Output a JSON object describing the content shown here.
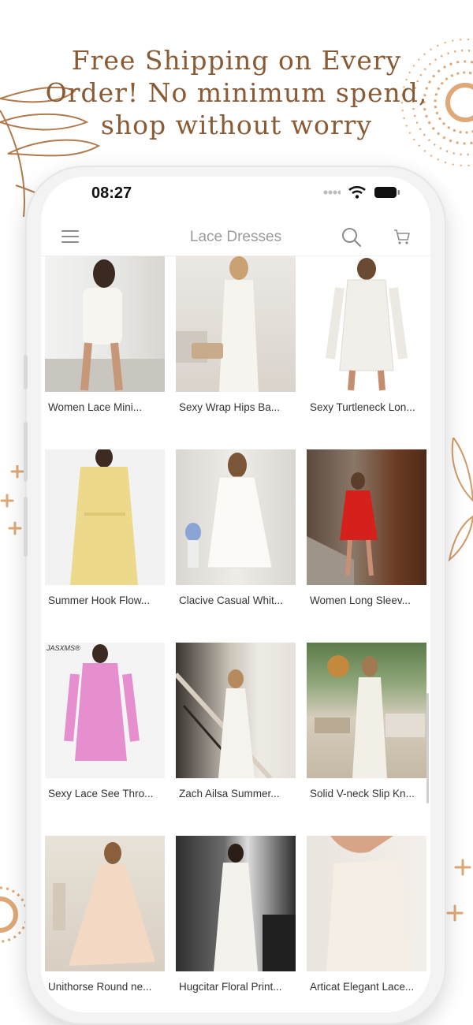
{
  "promo": {
    "line1": "Free Shipping on Every",
    "line2": "Order! No minimum spend,",
    "line3": "shop without worry"
  },
  "status": {
    "time": "08:27"
  },
  "header": {
    "title": "Lace Dresses",
    "menu_icon": "hamburger-menu-icon",
    "search_icon": "search-icon",
    "cart_icon": "cart-icon"
  },
  "products": [
    {
      "name": "Women Lace Mini Dress",
      "display": "Women Lace Mini..."
    },
    {
      "name": "Sexy Wrap Hips Ba...",
      "display": "Sexy Wrap Hips Ba..."
    },
    {
      "name": "Sexy Turtleneck Lon...",
      "display": "Sexy Turtleneck Lon..."
    },
    {
      "name": "Summer Hook Flow...",
      "display": "Summer Hook Flow..."
    },
    {
      "name": "Clacive Casual Whit...",
      "display": "Clacive Casual Whit..."
    },
    {
      "name": "Women Long Sleev...",
      "display": "Women Long Sleev..."
    },
    {
      "name": "Sexy Lace See Thro...",
      "display": "Sexy Lace See Thro..."
    },
    {
      "name": "Zach Ailsa Summer...",
      "display": "Zach Ailsa Summer..."
    },
    {
      "name": "Solid V-neck Slip Kn...",
      "display": "Solid V-neck Slip Kn..."
    },
    {
      "name": "Unithorse Round ne...",
      "display": "Unithorse Round ne..."
    },
    {
      "name": "Hugcitar Floral Print...",
      "display": "Hugcitar Floral Print..."
    },
    {
      "name": "Articat Elegant Lace...",
      "display": "Articat Elegant Lace..."
    }
  ],
  "watermark": "JASXMS®",
  "colors": {
    "accent": "#8a5a34",
    "deco": "#e0a877"
  }
}
